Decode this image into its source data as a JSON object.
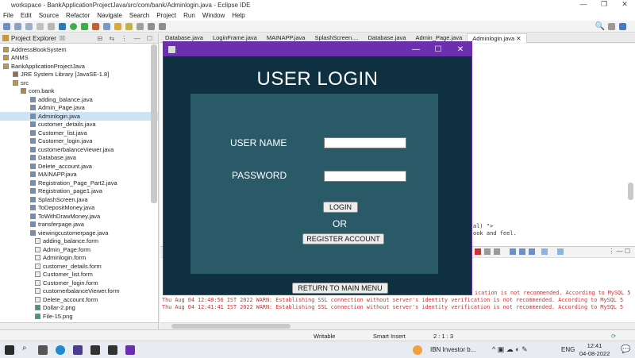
{
  "window": {
    "title": "workspace - BankApplicationProjectJava/src/com/bank/Adminlogin.java - Eclipse IDE"
  },
  "menu": [
    "File",
    "Edit",
    "Source",
    "Refactor",
    "Navigate",
    "Search",
    "Project",
    "Run",
    "Window",
    "Help"
  ],
  "explorer": {
    "title": "Project Explorer",
    "items": [
      {
        "label": "AddressBookSystem"
      },
      {
        "label": "ANMS"
      },
      {
        "label": "BankApplicationProjectJava"
      },
      {
        "label": "JRE System Library [JavaSE-1.8]"
      },
      {
        "label": "src"
      },
      {
        "label": "com.bank"
      },
      {
        "label": "adding_balance.java"
      },
      {
        "label": "Admin_Page.java"
      },
      {
        "label": "Adminlogin.java"
      },
      {
        "label": "customer_details.java"
      },
      {
        "label": "Customer_list.java"
      },
      {
        "label": "Customer_login.java"
      },
      {
        "label": "customerbalanceViewer.java"
      },
      {
        "label": "Database.java"
      },
      {
        "label": "Delete_account.java"
      },
      {
        "label": "MAINAPP.java"
      },
      {
        "label": "Registration_Page_Part2.java"
      },
      {
        "label": "Registration_page1.java"
      },
      {
        "label": "SplashScreen.java"
      },
      {
        "label": "ToDepositMoney.java"
      },
      {
        "label": "ToWithDrawMoney.java"
      },
      {
        "label": "transferpage.java"
      },
      {
        "label": "viewingcustomerpage.java"
      },
      {
        "label": "adding_balance.form"
      },
      {
        "label": "Admin_Page.form"
      },
      {
        "label": "Adminlogin.form"
      },
      {
        "label": "customer_details.form"
      },
      {
        "label": "Customer_list.form"
      },
      {
        "label": "Customer_login.form"
      },
      {
        "label": "customerbalanceViewer.form"
      },
      {
        "label": "Delete_account.form"
      },
      {
        "label": "Dollar-2.png"
      },
      {
        "label": "File-15.png"
      }
    ]
  },
  "tabs": [
    "Database.java",
    "LoginFrame.java",
    "MAINAPP.java",
    "SplashScreen....",
    "Database.java",
    "Admin_Page.java",
    "Adminlogin.java"
  ],
  "editor": {
    "snippet1": "al) \">",
    "snippet2": "ook and feel."
  },
  "console": {
    "lines": [
      "Thu Aug 04 12:40:56 IST 2022 WARN: Establishing SSL connection without server's identity verification is not recommended. According to MySQL 5",
      "Thu Aug 04 12:41:41 IST 2022 WARN: Establishing SSL connection without server's identity verification is not recommended. According to MySQL 5"
    ],
    "partial": "ication is not recommended. According to MySQL 5"
  },
  "status": {
    "writable": "Writable",
    "insert": "Smart Insert",
    "pos": "2 : 1 : 3"
  },
  "taskbar": {
    "news": "IBN  Investor b...",
    "lang": "ENG",
    "time": "12:41",
    "date": "04-08-2022"
  },
  "swing": {
    "title": "USER LOGIN",
    "username_label": "USER NAME",
    "password_label": "PASSWORD",
    "login_button": "LOGIN",
    "or_text": "OR",
    "register_button": "REGISTER ACCOUNT",
    "return_button": "RETURN TO MAIN MENU",
    "colors": {
      "titlebar": "#6c2fb0",
      "background": "#0e3040",
      "panel": "#2a5a68"
    }
  }
}
